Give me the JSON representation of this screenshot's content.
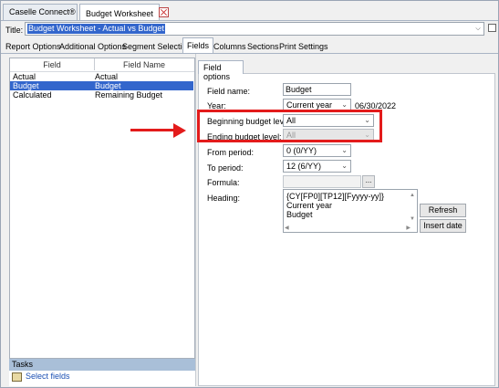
{
  "doc_tabs": [
    {
      "label": "Caselle Connect®"
    },
    {
      "label": "Budget Worksheet"
    }
  ],
  "title_row": {
    "label": "Title:",
    "value": "Budget Worksheet - Actual vs Budget"
  },
  "main_tabs": [
    "Report Options",
    "Additional Options",
    "Segment Selection",
    "Fields",
    "Columns",
    "Sections",
    "Print Settings"
  ],
  "active_main_tab": "Fields",
  "fields_table": {
    "headers": [
      "Field",
      "Field Name"
    ],
    "rows": [
      {
        "field": "Actual",
        "name": "Actual"
      },
      {
        "field": "Budget",
        "name": "Budget"
      },
      {
        "field": "Calculated",
        "name": "Remaining Budget"
      }
    ],
    "selected_row": 1
  },
  "tasks": {
    "header": "Tasks",
    "items": [
      {
        "label": "Select fields"
      }
    ]
  },
  "field_options": {
    "tab_label": "Field options",
    "field_name": {
      "label": "Field name:",
      "value": "Budget"
    },
    "year": {
      "label": "Year:",
      "value": "Current year",
      "date": "06/30/2022"
    },
    "beginning_budget_level": {
      "label": "Beginning budget level:",
      "value": "All"
    },
    "ending_budget_level": {
      "label": "Ending budget level:",
      "value": "All",
      "disabled": true
    },
    "from_period": {
      "label": "From period:",
      "value": "0 (0/YY)"
    },
    "to_period": {
      "label": "To period:",
      "value": "12 (6/YY)"
    },
    "formula": {
      "label": "Formula:",
      "value": "",
      "button": "..."
    },
    "heading": {
      "label": "Heading:",
      "lines": [
        "{CY[FP0][TP12][Fyyyy-yy]}",
        "Current year",
        "Budget"
      ]
    },
    "buttons": {
      "refresh": "Refresh",
      "insert_date": "Insert date"
    }
  },
  "annotation": {
    "color": "#e31b1b"
  },
  "colors": {
    "selection": "#3366cc",
    "link": "#1a4fb3",
    "tasks_bar": "#a9bfd8"
  }
}
